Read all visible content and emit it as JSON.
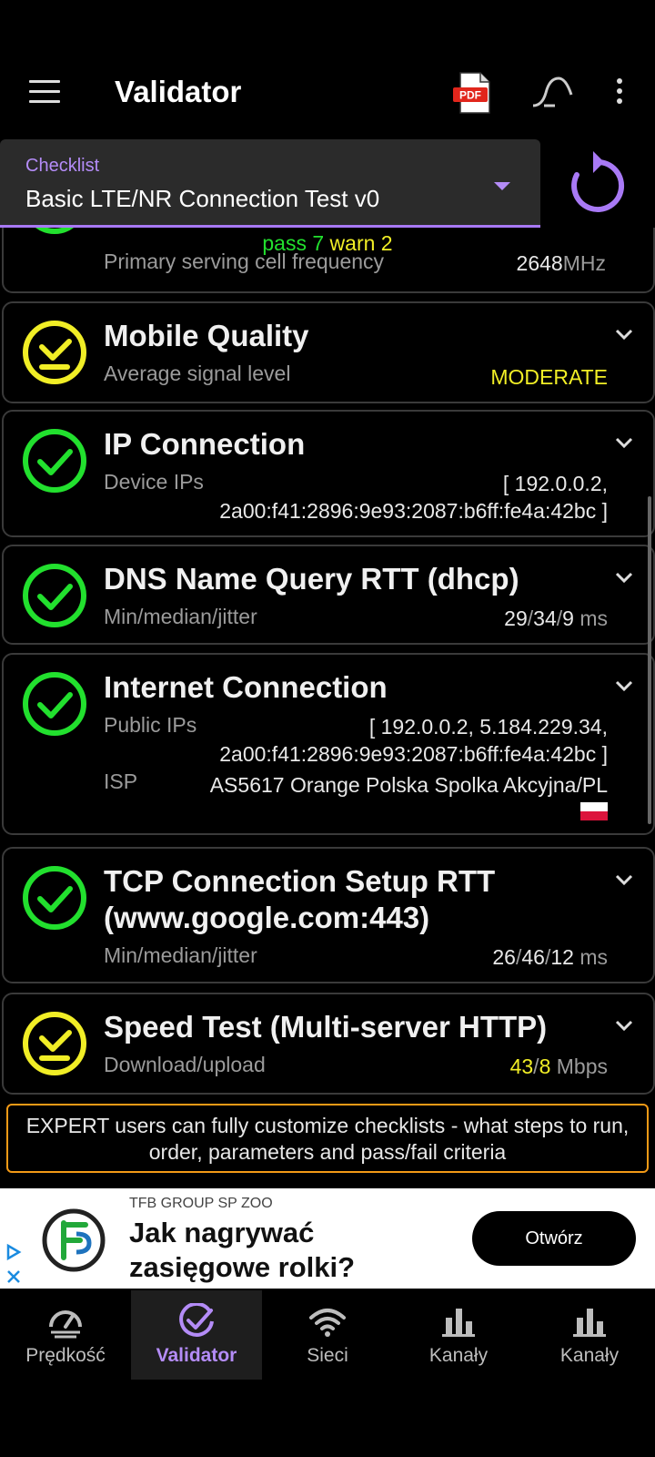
{
  "app": {
    "title": "Validator"
  },
  "checklist": {
    "label": "Checklist",
    "value": "Basic LTE/NR Connection Test v0"
  },
  "summary": {
    "pass": "pass 7",
    "warn": "warn 2"
  },
  "cards": {
    "frequency": {
      "sub": "Primary serving cell frequency",
      "value": "2648",
      "unit": "MHz",
      "status": "pass"
    },
    "mobile_quality": {
      "title": "Mobile Quality",
      "sub": "Average signal level",
      "value": "MODERATE",
      "status": "warn"
    },
    "ip_connection": {
      "title": "IP Connection",
      "sub": "Device IPs",
      "value_line1": "[ 192.0.0.2,",
      "value_line2": "2a00:f41:2896:9e93:2087:b6ff:fe4a:42bc ]",
      "status": "pass"
    },
    "dns": {
      "title": "DNS Name Query RTT (dhcp)",
      "sub": "Min/median/jitter",
      "v1": "29",
      "v2": "34",
      "v3": "9",
      "unit": "ms",
      "status": "pass"
    },
    "internet": {
      "title": "Internet Connection",
      "sub": "Public IPs",
      "value_line1": "[ 192.0.0.2, 5.184.229.34,",
      "value_line2": "2a00:f41:2896:9e93:2087:b6ff:fe4a:42bc ]",
      "isp_label": "ISP",
      "isp_value": "AS5617 Orange Polska Spolka Akcyjna/PL",
      "status": "pass"
    },
    "tcp": {
      "title_line1": "TCP Connection Setup RTT",
      "title_line2": "(www.google.com:443)",
      "sub": "Min/median/jitter",
      "v1": "26",
      "v2": "46",
      "v3": "12",
      "unit": "ms",
      "status": "pass"
    },
    "speed": {
      "title": "Speed Test (Multi-server HTTP)",
      "sub": "Download/upload",
      "v1": "43",
      "v2": "8",
      "unit": "Mbps",
      "status": "warn"
    }
  },
  "notice": "EXPERT users can fully customize checklists - what steps to run, order, parameters and pass/fail criteria",
  "ad": {
    "company": "TFB GROUP SP ZOO",
    "headline_line1": "Jak nagrywać",
    "headline_line2": "zasięgowe rolki?",
    "cta": "Otwórz"
  },
  "nav": [
    {
      "label": "Prędkość",
      "icon": "speedometer-icon"
    },
    {
      "label": "Validator",
      "icon": "check-circle-icon"
    },
    {
      "label": "Sieci",
      "icon": "wifi-icon"
    },
    {
      "label": "Kanały",
      "icon": "bar-chart-icon"
    },
    {
      "label": "Kanały",
      "icon": "bar-chart-icon"
    }
  ],
  "colors": {
    "pass": "#22e02e",
    "warn": "#f1ee26",
    "accent": "#a879f5",
    "notice_border": "#f39a16"
  }
}
